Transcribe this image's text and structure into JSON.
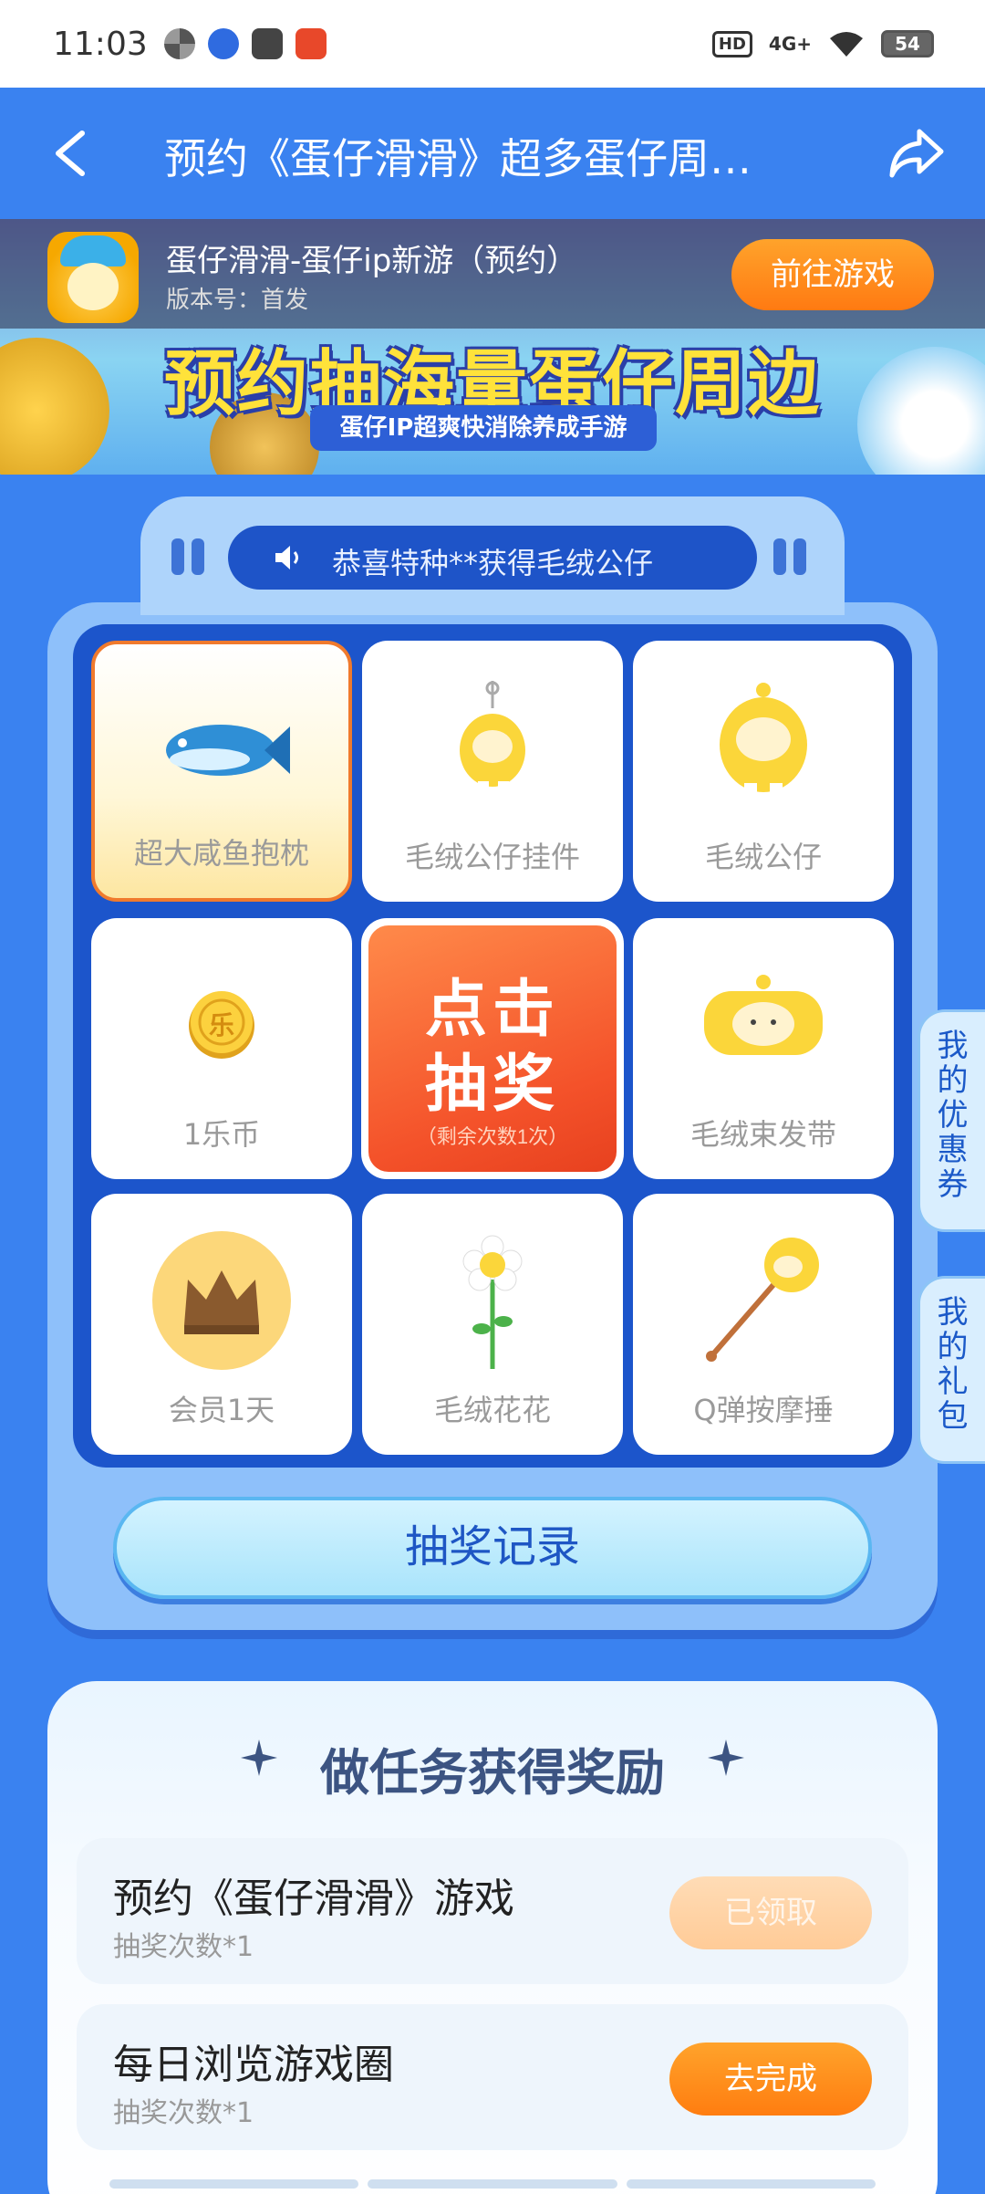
{
  "status_bar": {
    "time": "11:03",
    "hd": "HD",
    "signal": "4G+",
    "battery": "54"
  },
  "header": {
    "title": "预约《蛋仔滑滑》超多蛋仔周…"
  },
  "game": {
    "name": "蛋仔滑滑-蛋仔ip新游（预约）",
    "version": "版本号：首发",
    "go_button": "前往游戏"
  },
  "banner": {
    "headline": "预约抽海量蛋仔周边",
    "subtitle": "蛋仔IP超爽快消除养成手游"
  },
  "lottery": {
    "notice": "恭喜特种**获得毛绒公仔",
    "prizes": [
      {
        "label": "超大咸鱼抱枕",
        "icon": "fish-pillow-icon"
      },
      {
        "label": "毛绒公仔挂件",
        "icon": "plush-keychain-icon"
      },
      {
        "label": "毛绒公仔",
        "icon": "plush-doll-icon"
      },
      {
        "label": "1乐币",
        "icon": "coin-icon"
      },
      {
        "label": "毛绒束发带",
        "icon": "headband-icon"
      },
      {
        "label": "会员1天",
        "icon": "crown-icon"
      },
      {
        "label": "毛绒花花",
        "icon": "flower-icon"
      },
      {
        "label": "Q弹按摩捶",
        "icon": "massage-hammer-icon"
      }
    ],
    "draw_button": {
      "line1": "点击",
      "line2": "抽奖",
      "remaining": "（剩余次数1次）"
    },
    "record_button": "抽奖记录",
    "coin_glyph": "乐"
  },
  "side_tabs": {
    "coupons": [
      "我",
      "的",
      "优",
      "惠",
      "券"
    ],
    "gifts": [
      "我",
      "的",
      "礼",
      "包"
    ]
  },
  "tasks": {
    "title": "做任务获得奖励",
    "items": [
      {
        "name": "预约《蛋仔滑滑》游戏",
        "reward": "抽奖次数*1",
        "button": "已领取",
        "status": "done"
      },
      {
        "name": "每日浏览游戏圈",
        "reward": "抽奖次数*1",
        "button": "去完成",
        "status": "todo"
      }
    ]
  },
  "colors": {
    "page_bg": "#3a82f0",
    "accent_orange": "#ff7a12",
    "panel_blue": "#1c55cb"
  }
}
